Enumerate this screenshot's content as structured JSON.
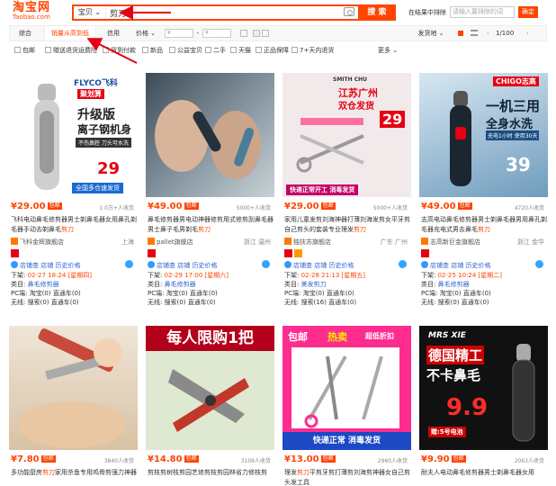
{
  "logo": {
    "cn": "淘宝网",
    "en": "Taobao.com"
  },
  "search": {
    "category": "宝贝 ⌄",
    "query": "剪刀",
    "button": "搜 索"
  },
  "in_search": {
    "label": "在结果中排除",
    "placeholder": "请输入要排除的词",
    "button": "确定"
  },
  "sort": {
    "items": [
      "综合",
      "销量从高到低",
      "信用",
      "价格 ⌄"
    ],
    "price_from": "¥",
    "price_to": "¥",
    "ship_from": "发货地 ⌄",
    "pager": "1/100",
    "prev": "‹",
    "next": "›"
  },
  "filters": [
    "包邮",
    "赠送退货运费险",
    "货到付款",
    "新品",
    "公益宝贝",
    "二手",
    "天猫",
    "正品保障",
    "7+天内退货",
    "更多 ⌄"
  ],
  "colors": {
    "accent": "#ff4400",
    "link": "#3366cc"
  },
  "products": [
    {
      "price": "¥29.00",
      "mail": "包邮",
      "sold": "1.0万+人收货",
      "title_pre": "飞科电动鼻毛修剪器男士剃鼻毛器女用鼻孔剃毛器手动去剃鼻毛",
      "title_hl": "剪刀",
      "shop": "飞科金辉旗舰店",
      "loc": "上海",
      "img": {
        "brand": "FLYCO飞科",
        "tag": "聚划算",
        "line1": "升级版",
        "line2": "离子钢机身",
        "line3": "不伤鼻腔 刀头可水洗",
        "price": "29",
        "foot": "全国多仓速发货"
      },
      "tools": "店铺查  店铺  历史价格",
      "down": "下架:",
      "down_val": "02-27 18:24 [星期四]",
      "cat": "类目:",
      "cat_val": "鼻毛修剪器",
      "pc": "PC端: 淘宝(0)  直通车(0)",
      "wx": "无线: 搜索(0)  直通车(0)"
    },
    {
      "price": "¥49.00",
      "mail": "包邮",
      "sold": "5000+人收货",
      "title_pre": "鼻毛修剪器男电动神器修剪用式修剪刮鼻毛器男士鼻子毛男剃毛",
      "title_hl": "剪刀",
      "shop": "pallet旗舰店",
      "loc": "浙江 温州",
      "img": {
        "brand": "",
        "tag": "",
        "line1": "",
        "line2": "",
        "line3": "",
        "price": "",
        "foot": ""
      },
      "tools": "店铺查  店铺  历史价格",
      "down": "下架:",
      "down_val": "02-29 17:00 [星期六]",
      "cat": "类目:",
      "cat_val": "鼻毛修剪器",
      "pc": "PC端: 淘宝(0)  直通车(0)",
      "wx": "无线: 搜索(0)  直通车(0)"
    },
    {
      "price": "¥29.00",
      "mail": "包邮",
      "sold": "5000+人收货",
      "title_pre": "家用儿童发剪刘海神器打薄刘海发剪女平牙剪自己剪头的套装专业理发",
      "title_hl": "剪刀",
      "shop": "独扶苏旗舰店",
      "loc": "广东 广州",
      "img": {
        "brand": "SMITH CHU",
        "tag": "",
        "line1": "江苏广州",
        "line2": "双仓发货",
        "line3": "快递正常开工 消毒发货",
        "price": "29",
        "foot": ""
      },
      "tools": "店铺查  店铺  历史价格",
      "down": "下架:",
      "down_val": "02-28 21:13 [星期五]",
      "cat": "类目:",
      "cat_val": "美发剪刀",
      "pc": "PC端: 淘宝(0)  直通车(0)",
      "wx": "无线: 搜索(16)  直通车(0)"
    },
    {
      "price": "¥49.00",
      "mail": "包邮",
      "sold": "4720人收货",
      "title_pre": "志高电动鼻毛修剪器男士剃鼻毛器男用鼻孔剃毛器充电式男去鼻毛",
      "title_hl": "剪刀",
      "shop": "志高新巨金旗舰店",
      "loc": "浙江 金华",
      "img": {
        "brand": "CHIGO志高",
        "tag": "",
        "line1": "一机三用",
        "line2": "全身水洗",
        "line3": "充电1小时 使用30天",
        "price": "39",
        "foot": ""
      },
      "tools": "店铺查  店铺  历史价格",
      "down": "下架:",
      "down_val": "02-25 10:24 [星期二]",
      "cat": "类目:",
      "cat_val": "鼻毛修剪器",
      "pc": "PC端: 淘宝(0)  直通车(0)",
      "wx": "无线: 搜索(0)  直通车(0)"
    },
    {
      "price": "¥7.80",
      "mail": "包邮",
      "sold": "3840人收货",
      "title_pre": "多功能厨房",
      "title_hl": "剪刀",
      "title_post": "家用杀鱼专用鸡骨剪强力神器",
      "img": {
        "line1": "",
        "line2": "",
        "line3": "",
        "price": ""
      }
    },
    {
      "price": "¥14.80",
      "mail": "包邮",
      "sold": "3109人收货",
      "title_pre": "剪枝剪树枝剪园艺修剪枝剪园林省力修枝剪",
      "title_hl": "",
      "img": {
        "line1": "每人限购1把",
        "line2": "",
        "line3": "",
        "price": ""
      }
    },
    {
      "price": "¥13.00",
      "mail": "包邮",
      "sold": "2960人收货",
      "title_pre": "理发",
      "title_hl": "剪刀",
      "title_post": "平剪牙剪打薄剪刘海剪神器女自己剪头发工具",
      "img": {
        "line1": "包邮",
        "line2": "热卖",
        "line3": "超低折扣",
        "tag": "快递正常 消毒发货",
        "price": ""
      }
    },
    {
      "price": "¥9.90",
      "mail": "包邮",
      "sold": "2063人收货",
      "title_pre": "耐夫人电动鼻毛修剪器男士剃鼻毛器女用",
      "title_hl": "",
      "img": {
        "brand": "MRS XIE",
        "line1": "德国精工",
        "line2": "不卡鼻毛",
        "line3": "赠:5号电池",
        "price": "9.9"
      }
    }
  ]
}
